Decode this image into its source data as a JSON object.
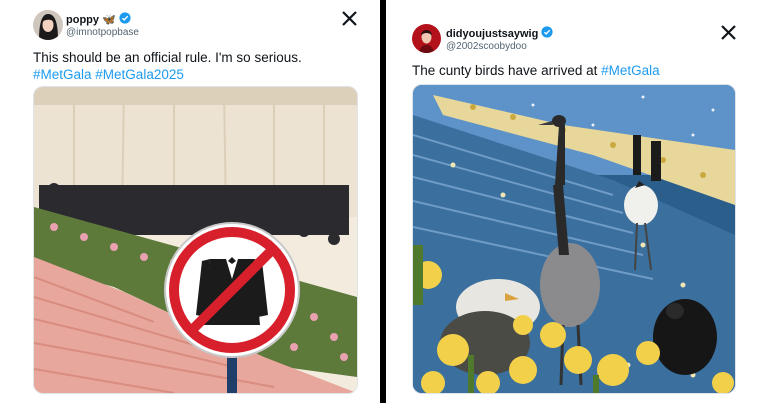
{
  "left_tweet": {
    "author_name": "poppy",
    "author_emoji": "🦋",
    "handle": "@imnotpopbase",
    "text": "This should be an official rule. I'm so serious.",
    "hashtags": [
      "#MetGala",
      "#MetGala2025"
    ],
    "icons": {
      "verified": "verified-badge-icon",
      "platform": "x-logo-icon"
    },
    "image": "red carpet staircase with crowd and a no-suit prohibition sign"
  },
  "right_tweet": {
    "author_name": "didyoujustsaywig",
    "handle": "@2002scoobydoo",
    "text": "The cunty birds have arrived at",
    "hashtag": "#MetGala",
    "icons": {
      "verified": "verified-badge-icon",
      "platform": "x-logo-icon"
    },
    "image": "cranes and birds on floral blue staircase"
  },
  "colors": {
    "hashtag": "#1d9bf0",
    "verified": "#1d9bf0",
    "divider": "#000000",
    "prohibition": "#d8202c"
  }
}
